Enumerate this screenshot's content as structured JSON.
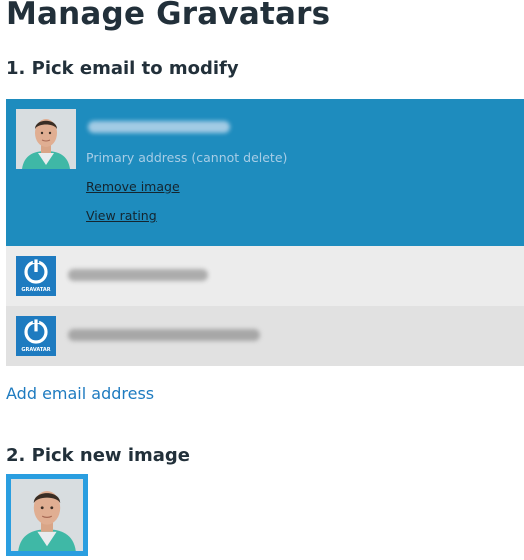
{
  "page": {
    "title": "Manage Gravatars"
  },
  "step1": {
    "title": "1. Pick email to modify"
  },
  "emails": [
    {
      "selected": true,
      "avatar": "user-photo",
      "primary_note": "Primary address (cannot delete)",
      "remove_label": "Remove image",
      "rating_label": "View rating"
    },
    {
      "selected": false,
      "avatar": "gravatar-logo-icon"
    },
    {
      "selected": false,
      "avatar": "gravatar-logo-icon"
    }
  ],
  "gravatar_logo_text": "GRAVATAR",
  "add_email_label": "Add email address",
  "step2": {
    "title": "2. Pick new image"
  },
  "colors": {
    "selected_row": "#1e8cbe",
    "link": "#1e7bc0",
    "image_border": "#2a9ee0"
  }
}
